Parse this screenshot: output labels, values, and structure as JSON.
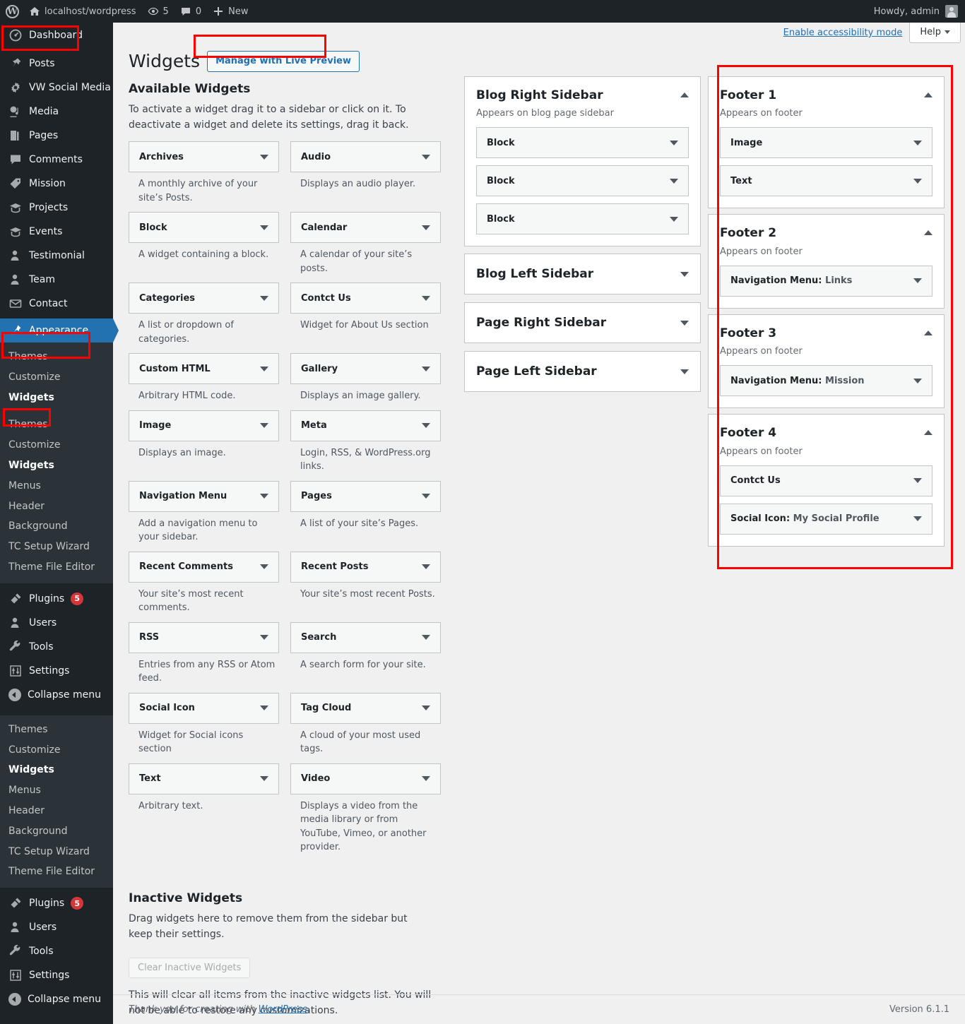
{
  "adminbar": {
    "logo_icon": "wordpress-logo-icon",
    "site_icon": "home-icon",
    "site_name": "localhost/wordpress",
    "updates_icon": "updates-icon",
    "updates_count": "5",
    "comments_icon": "comment-bubble-icon",
    "comments_count": "0",
    "new_icon": "plus-icon",
    "new_label": "New",
    "howdy": "Howdy, admin",
    "avatar_icon": "avatar-icon"
  },
  "sidebar": {
    "top_items": [
      {
        "label": "Dashboard",
        "icon": "dashboard-icon"
      },
      {
        "label": "Posts",
        "icon": "pin-icon"
      },
      {
        "label": "VW Social Media",
        "icon": "gear-icon"
      },
      {
        "label": "Media",
        "icon": "media-icon"
      },
      {
        "label": "Pages",
        "icon": "pages-icon"
      },
      {
        "label": "Comments",
        "icon": "comment-bubble-icon"
      },
      {
        "label": "Mission",
        "icon": "tag-icon"
      },
      {
        "label": "Projects",
        "icon": "portfolio-icon"
      },
      {
        "label": "Events",
        "icon": "portfolio-icon"
      },
      {
        "label": "Testimonial",
        "icon": "user-icon"
      },
      {
        "label": "Team",
        "icon": "user-icon"
      },
      {
        "label": "Contact",
        "icon": "envelope-icon"
      },
      {
        "label": "Appearance",
        "icon": "brush-icon",
        "current": true
      }
    ],
    "appearance_submenu": [
      {
        "label": "Themes"
      },
      {
        "label": "Customize"
      },
      {
        "label": "Widgets",
        "current": true
      }
    ],
    "appearance_submenu_full": [
      {
        "label": "Themes"
      },
      {
        "label": "Customize"
      },
      {
        "label": "Widgets",
        "current": true
      },
      {
        "label": "Menus"
      },
      {
        "label": "Header"
      },
      {
        "label": "Background"
      },
      {
        "label": "TC Setup Wizard"
      },
      {
        "label": "Theme File Editor"
      }
    ],
    "bottom_items": [
      {
        "label": "Plugins",
        "icon": "plug-icon",
        "badge": "5"
      },
      {
        "label": "Users",
        "icon": "user-icon"
      },
      {
        "label": "Tools",
        "icon": "wrench-icon"
      },
      {
        "label": "Settings",
        "icon": "sliders-icon"
      },
      {
        "label": "Collapse menu",
        "icon": "collapse-icon"
      }
    ]
  },
  "screen_meta": {
    "accessibility_link": "Enable accessibility mode",
    "help_label": "Help",
    "help_caret_icon": "chevron-down-icon"
  },
  "page": {
    "title": "Widgets",
    "action_button": "Manage with Live Preview"
  },
  "available": {
    "heading": "Available Widgets",
    "description": "To activate a widget drag it to a sidebar or click on it. To deactivate a widget and delete its settings, drag it back.",
    "widgets": [
      {
        "name": "Archives",
        "desc": "A monthly archive of your site’s Posts."
      },
      {
        "name": "Audio",
        "desc": "Displays an audio player."
      },
      {
        "name": "Block",
        "desc": "A widget containing a block."
      },
      {
        "name": "Calendar",
        "desc": "A calendar of your site’s posts."
      },
      {
        "name": "Categories",
        "desc": "A list or dropdown of categories."
      },
      {
        "name": "Contct Us",
        "desc": "Widget for About Us section"
      },
      {
        "name": "Custom HTML",
        "desc": "Arbitrary HTML code."
      },
      {
        "name": "Gallery",
        "desc": "Displays an image gallery."
      },
      {
        "name": "Image",
        "desc": "Displays an image."
      },
      {
        "name": "Meta",
        "desc": "Login, RSS, & WordPress.org links."
      },
      {
        "name": "Navigation Menu",
        "desc": "Add a navigation menu to your sidebar."
      },
      {
        "name": "Pages",
        "desc": "A list of your site’s Pages."
      },
      {
        "name": "Recent Comments",
        "desc": "Your site’s most recent comments."
      },
      {
        "name": "Recent Posts",
        "desc": "Your site’s most recent Posts."
      },
      {
        "name": "RSS",
        "desc": "Entries from any RSS or Atom feed."
      },
      {
        "name": "Search",
        "desc": "A search form for your site."
      },
      {
        "name": "Social Icon",
        "desc": "Widget for Social icons section"
      },
      {
        "name": "Tag Cloud",
        "desc": "A cloud of your most used tags."
      },
      {
        "name": "Text",
        "desc": "Arbitrary text."
      },
      {
        "name": "Video",
        "desc": "Displays a video from the media library or from YouTube, Vimeo, or another provider."
      }
    ]
  },
  "inactive": {
    "heading": "Inactive Widgets",
    "description": "Drag widgets here to remove them from the sidebar but keep their settings.",
    "clear_button": "Clear Inactive Widgets",
    "note": "This will clear all items from the inactive widgets list. You will not be able to restore any customizations."
  },
  "sidebars_middle": [
    {
      "name": "Blog Right Sidebar",
      "desc": "Appears on blog page sidebar",
      "open": true,
      "toggle_icon": "chevron-up-icon",
      "widgets": [
        {
          "title": "Block",
          "sub": ""
        },
        {
          "title": "Block",
          "sub": ""
        },
        {
          "title": "Block",
          "sub": ""
        }
      ]
    },
    {
      "name": "Blog Left Sidebar",
      "desc": "",
      "open": false,
      "toggle_icon": "chevron-down-icon",
      "widgets": []
    },
    {
      "name": "Page Right Sidebar",
      "desc": "",
      "open": false,
      "toggle_icon": "chevron-down-icon",
      "widgets": []
    },
    {
      "name": "Page Left Sidebar",
      "desc": "",
      "open": false,
      "toggle_icon": "chevron-down-icon",
      "widgets": []
    }
  ],
  "sidebars_right": [
    {
      "name": "Footer 1",
      "desc": "Appears on footer",
      "open": true,
      "toggle_icon": "chevron-up-icon",
      "widgets": [
        {
          "title": "Image",
          "sub": ""
        },
        {
          "title": "Text",
          "sub": ""
        }
      ]
    },
    {
      "name": "Footer 2",
      "desc": "Appears on footer",
      "open": true,
      "toggle_icon": "chevron-up-icon",
      "widgets": [
        {
          "title": "Navigation Menu:",
          "sub": " Links"
        }
      ]
    },
    {
      "name": "Footer 3",
      "desc": "Appears on footer",
      "open": true,
      "toggle_icon": "chevron-up-icon",
      "widgets": [
        {
          "title": "Navigation Menu:",
          "sub": " Mission"
        }
      ]
    },
    {
      "name": "Footer 4",
      "desc": "Appears on footer",
      "open": true,
      "toggle_icon": "chevron-up-icon",
      "widgets": [
        {
          "title": "Contct Us",
          "sub": ""
        },
        {
          "title": "Social Icon:",
          "sub": " My Social Profile"
        }
      ]
    }
  ],
  "footer": {
    "thanks_prefix": "Thank you for creating with ",
    "thanks_link": "WordPress",
    "thanks_suffix": ".",
    "version": "Version 6.1.1"
  },
  "colors": {
    "accent": "#2271b1",
    "admin_bg": "#1d2327",
    "submenu_bg": "#2c3338",
    "badge": "#d63638",
    "annotation": "#ff0000"
  }
}
